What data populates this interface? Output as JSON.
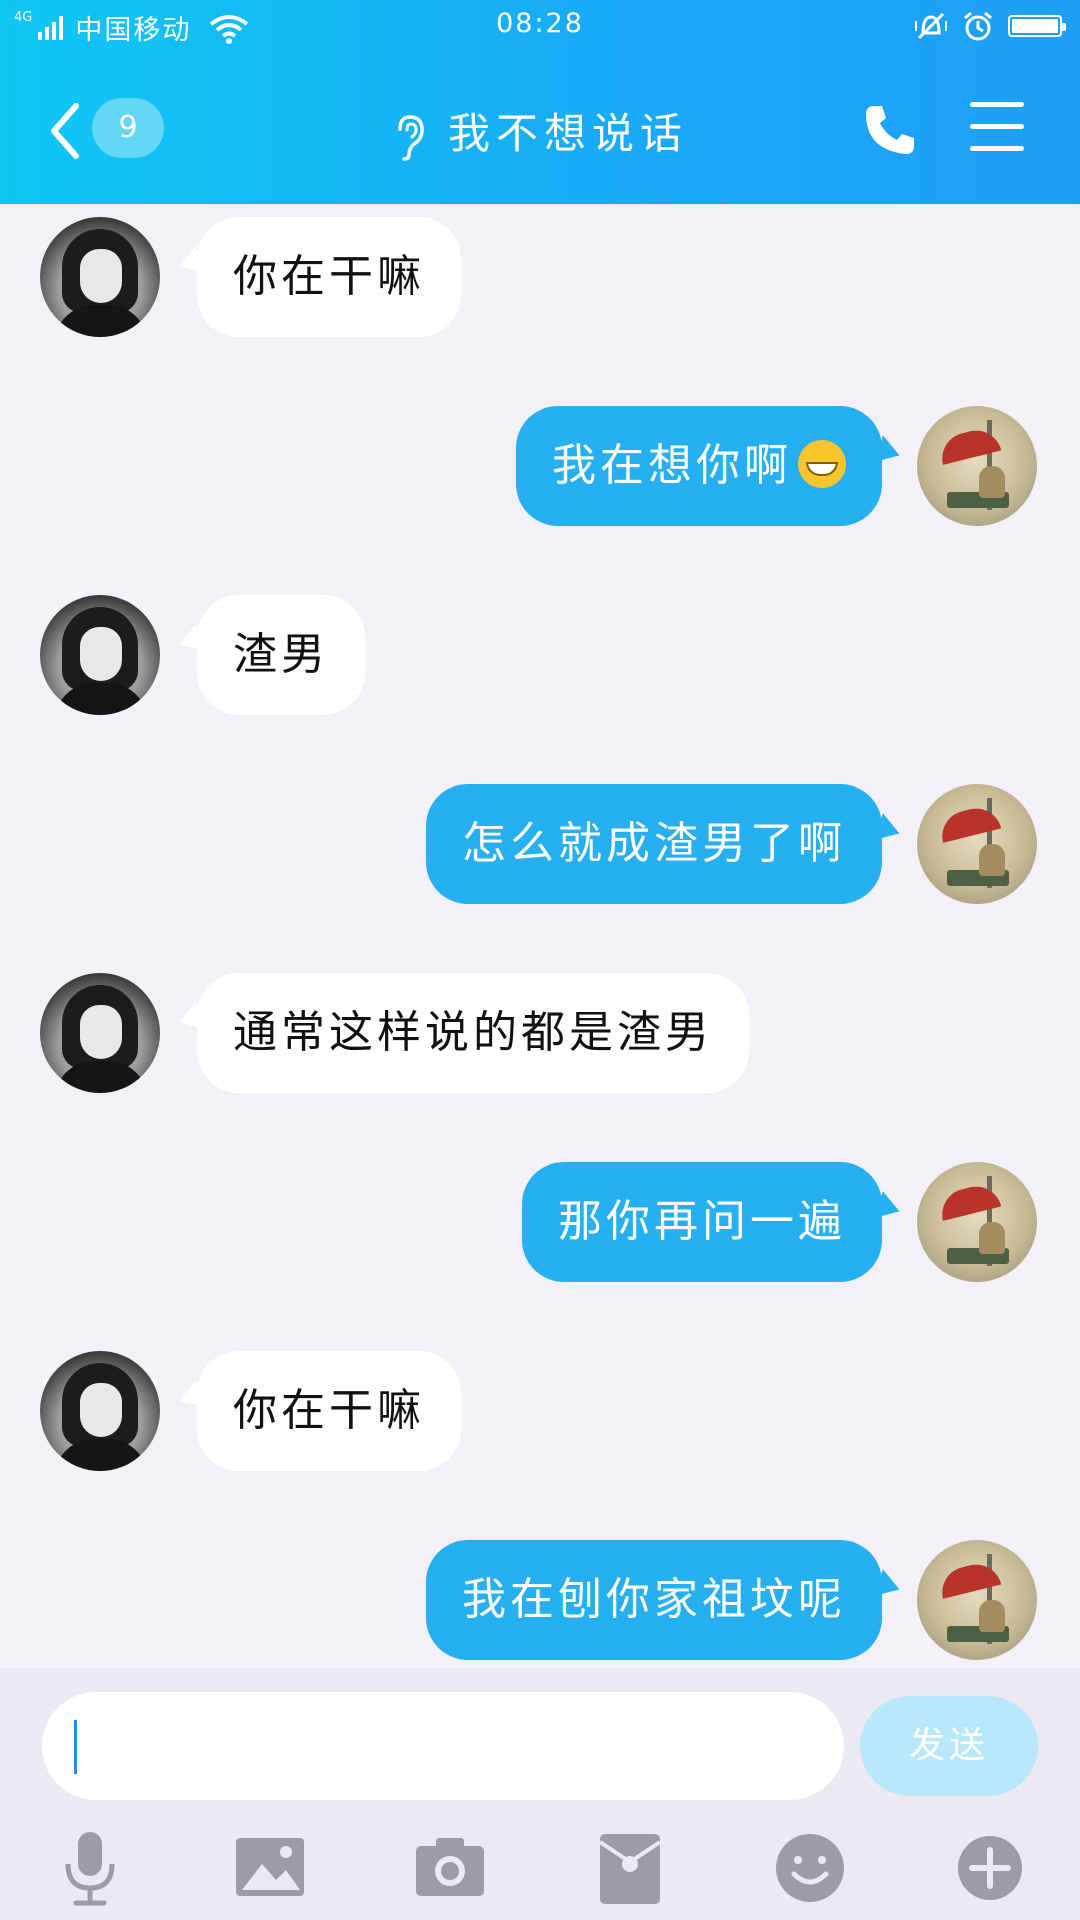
{
  "status_bar": {
    "network": "4G",
    "carrier": "中国移动",
    "time": "08:28"
  },
  "header": {
    "unread_count": "9",
    "title": "我不想说话"
  },
  "messages": [
    {
      "side": "in",
      "text": "你在干嘛"
    },
    {
      "side": "out",
      "text": "我在想你啊",
      "emoji": "grinning-face"
    },
    {
      "side": "in",
      "text": "渣男"
    },
    {
      "side": "out",
      "text": "怎么就成渣男了啊"
    },
    {
      "side": "in",
      "text": "通常这样说的都是渣男"
    },
    {
      "side": "out",
      "text": "那你再问一遍"
    },
    {
      "side": "in",
      "text": "你在干嘛"
    },
    {
      "side": "out",
      "text": "我在刨你家祖坟呢"
    }
  ],
  "input": {
    "value": "",
    "send_label": "发送"
  },
  "toolbar_icons": [
    "microphone-icon",
    "image-icon",
    "camera-icon",
    "red-packet-icon",
    "emoji-icon",
    "plus-icon"
  ],
  "colors": {
    "header_start": "#0fc7f3",
    "header_end": "#1e9ff5",
    "outgoing_bubble": "#27b0f1",
    "incoming_bubble": "#ffffff",
    "chat_background": "#f3f0f7",
    "send_button": "#b9e8fb"
  }
}
